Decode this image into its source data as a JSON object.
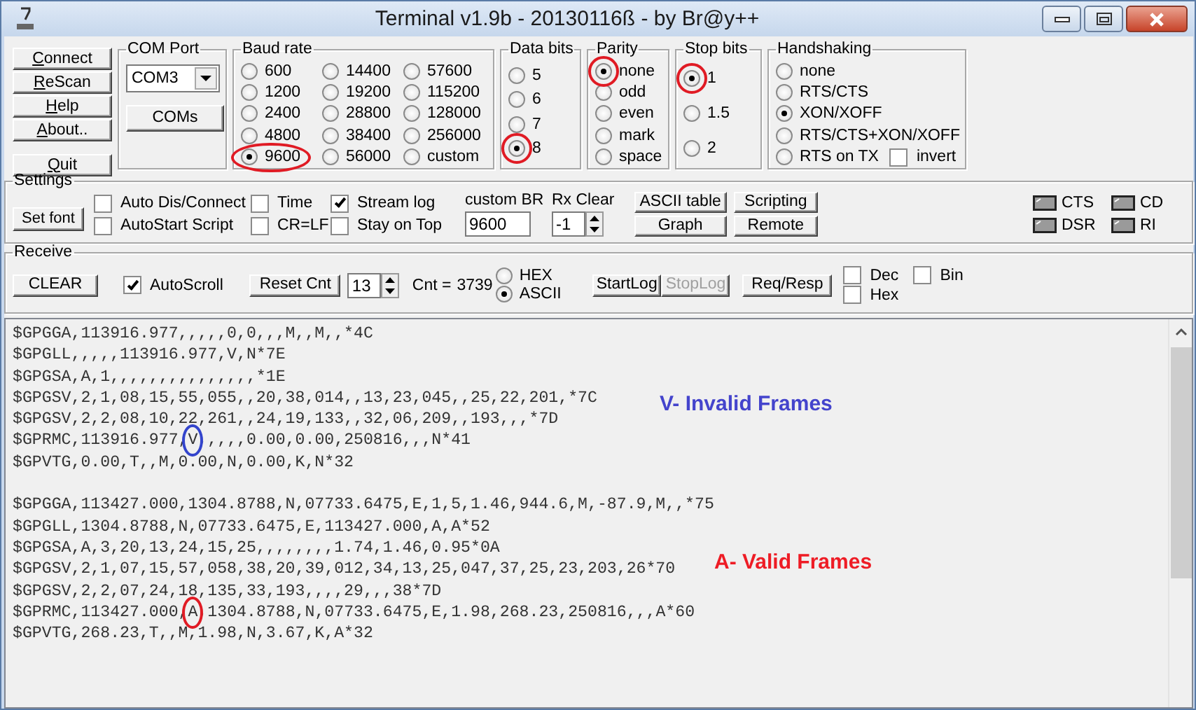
{
  "window": {
    "title": "Terminal v1.9b - 20130116ß - by Br@y++"
  },
  "side_buttons": [
    {
      "label": "Connect",
      "mnemonic": true
    },
    {
      "label": "ReScan",
      "mnemonic": true
    },
    {
      "label": "Help",
      "mnemonic": true
    },
    {
      "label": "About..",
      "mnemonic": true
    },
    {
      "label": "Quit",
      "mnemonic": true
    }
  ],
  "com_port": {
    "title": "COM Port",
    "value": "COM3",
    "button": "COMs"
  },
  "baud_rate": {
    "title": "Baud rate",
    "options": [
      {
        "label": "600",
        "selected": false
      },
      {
        "label": "14400",
        "selected": false
      },
      {
        "label": "57600",
        "selected": false
      },
      {
        "label": "1200",
        "selected": false
      },
      {
        "label": "19200",
        "selected": false
      },
      {
        "label": "115200",
        "selected": false
      },
      {
        "label": "2400",
        "selected": false
      },
      {
        "label": "28800",
        "selected": false
      },
      {
        "label": "128000",
        "selected": false
      },
      {
        "label": "4800",
        "selected": false
      },
      {
        "label": "38400",
        "selected": false
      },
      {
        "label": "256000",
        "selected": false
      },
      {
        "label": "9600",
        "selected": true,
        "circled_with_label": true
      },
      {
        "label": "56000",
        "selected": false
      },
      {
        "label": "custom",
        "selected": false
      }
    ]
  },
  "data_bits": {
    "title": "Data bits",
    "options": [
      {
        "label": "5",
        "selected": false
      },
      {
        "label": "6",
        "selected": false
      },
      {
        "label": "7",
        "selected": false
      },
      {
        "label": "8",
        "selected": true,
        "circled": true
      }
    ]
  },
  "parity": {
    "title": "Parity",
    "options": [
      {
        "label": "none",
        "selected": true,
        "circled": true
      },
      {
        "label": "odd",
        "selected": false
      },
      {
        "label": "even",
        "selected": false
      },
      {
        "label": "mark",
        "selected": false
      },
      {
        "label": "space",
        "selected": false
      }
    ]
  },
  "stop_bits": {
    "title": "Stop bits",
    "options": [
      {
        "label": "1",
        "selected": true,
        "circled": true
      },
      {
        "label": "1.5",
        "selected": false
      },
      {
        "label": "2",
        "selected": false
      }
    ]
  },
  "handshaking": {
    "title": "Handshaking",
    "options": [
      {
        "label": "none",
        "selected": false
      },
      {
        "label": "RTS/CTS",
        "selected": false
      },
      {
        "label": "XON/XOFF",
        "selected": true
      },
      {
        "label": "RTS/CTS+XON/XOFF",
        "selected": false
      },
      {
        "label": "RTS on TX",
        "selected": false
      }
    ],
    "invert": {
      "label": "invert",
      "checked": false
    }
  },
  "settings": {
    "title": "Settings",
    "set_font": "Set font",
    "checks": [
      {
        "label": "Auto Dis/Connect",
        "checked": false
      },
      {
        "label": "Time",
        "checked": false
      },
      {
        "label": "Stream log",
        "checked": true
      },
      {
        "label": "AutoStart Script",
        "checked": false
      },
      {
        "label": "CR=LF",
        "checked": false
      },
      {
        "label": "Stay on Top",
        "checked": false
      }
    ],
    "custom_br": {
      "label": "custom BR",
      "value": "9600"
    },
    "rx_clear": {
      "label": "Rx Clear",
      "value": "-1"
    },
    "buttons": [
      "ASCII table",
      "Scripting",
      "Graph",
      "Remote"
    ],
    "signals": [
      {
        "label": "CTS",
        "on": false
      },
      {
        "label": "CD",
        "on": false
      },
      {
        "label": "DSR",
        "on": false
      },
      {
        "label": "RI",
        "on": false
      }
    ]
  },
  "receive": {
    "title": "Receive",
    "clear": "CLEAR",
    "autoscroll": {
      "label": "AutoScroll",
      "checked": true
    },
    "reset": "Reset Cnt",
    "spinner": "13",
    "count_label": "Cnt =",
    "count": "3739",
    "format": [
      {
        "label": "HEX",
        "selected": false
      },
      {
        "label": "ASCII",
        "selected": true
      }
    ],
    "log_buttons": [
      {
        "label": "StartLog",
        "disabled": false
      },
      {
        "label": "StopLog",
        "disabled": true
      }
    ],
    "req_resp": "Req/Resp",
    "display_checks": [
      {
        "label": "Dec",
        "checked": false
      },
      {
        "label": "Bin",
        "checked": false
      },
      {
        "label": "Hex",
        "checked": false
      }
    ]
  },
  "log": {
    "frames": [
      {
        "lines": [
          {
            "kind": "plain",
            "text": "$GPGGA,113916.977,,,,,0,0,,,M,,M,,*4C"
          },
          {
            "kind": "plain",
            "text": "$GPGLL,,,,,113916.977,V,N*7E"
          },
          {
            "kind": "plain",
            "text": "$GPGSA,A,1,,,,,,,,,,,,,,,*1E"
          },
          {
            "kind": "plain",
            "text": "$GPGSV,2,1,08,15,55,055,,20,38,014,,13,23,045,,25,22,201,*7C"
          },
          {
            "kind": "plain",
            "text": "$GPGSV,2,2,08,10,22,261,,24,19,133,,32,06,209,,193,,,*7D"
          },
          {
            "kind": "circled",
            "before": "$GPRMC,113916.977,",
            "mark": "V",
            "after": ",,,,,0.00,0.00,250816,,,N*41",
            "color": "#3344cc"
          },
          {
            "kind": "plain",
            "text": "$GPVTG,0.00,T,,M,0.00,N,0.00,K,N*32"
          }
        ]
      },
      {
        "lines": [
          {
            "kind": "plain",
            "text": "$GPGGA,113427.000,1304.8788,N,07733.6475,E,1,5,1.46,944.6,M,-87.9,M,,*75"
          },
          {
            "kind": "plain",
            "text": "$GPGLL,1304.8788,N,07733.6475,E,113427.000,A,A*52"
          },
          {
            "kind": "plain",
            "text": "$GPGSA,A,3,20,13,24,15,25,,,,,,,,1.74,1.46,0.95*0A"
          },
          {
            "kind": "plain",
            "text": "$GPGSV,2,1,07,15,57,058,38,20,39,012,34,13,25,047,37,25,23,203,26*70"
          },
          {
            "kind": "plain",
            "text": "$GPGSV,2,2,07,24,18,135,33,193,,,,29,,,38*7D"
          },
          {
            "kind": "circled",
            "before": "$GPRMC,113427.000,",
            "mark": "A",
            "after": ",1304.8788,N,07733.6475,E,1.98,268.23,250816,,,A*60",
            "color": "#e01b24"
          },
          {
            "kind": "plain",
            "text": "$GPVTG,268.23,T,,M,1.98,N,3.67,K,A*32"
          }
        ]
      }
    ],
    "annotations": [
      {
        "text": "V- Invalid Frames",
        "color": "#4444cc"
      },
      {
        "text": "A- Valid Frames",
        "color": "#ee1c25"
      }
    ]
  }
}
